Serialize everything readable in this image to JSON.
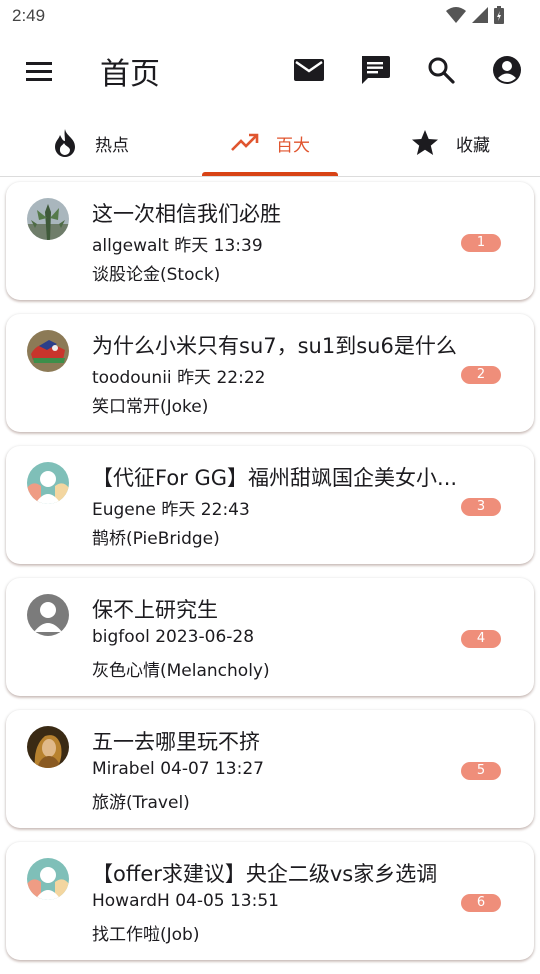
{
  "status_bar": {
    "time": "2:49"
  },
  "app_bar": {
    "title": "首页",
    "icons": [
      "menu-icon",
      "mail-icon",
      "chat-icon",
      "search-icon",
      "account-icon"
    ]
  },
  "tabs": [
    {
      "label": "热点",
      "icon": "flame-icon",
      "active": false
    },
    {
      "label": "百大",
      "icon": "trending-up-icon",
      "active": true
    },
    {
      "label": "收藏",
      "icon": "star-icon",
      "active": false
    }
  ],
  "colors": {
    "accent": "#e0552f",
    "indicator": "#d84315",
    "badge": "#ef8e7a"
  },
  "posts": [
    {
      "title": "这一次相信我们必胜",
      "author": "allgewalt",
      "time": "昨天 13:39",
      "board": "谈股论金(Stock)",
      "rank": "1",
      "avatar": "photo-cactus"
    },
    {
      "title": "为什么小米只有su7，su1到su6是什么",
      "author": "toodounii",
      "time": "昨天 22:22",
      "board": "笑口常开(Joke)",
      "rank": "2",
      "avatar": "photo-sneaker"
    },
    {
      "title": "【代征For GG】福州甜飒国企美女小...",
      "author": "Eugene",
      "time": "昨天 22:43",
      "board": "鹊桥(PieBridge)",
      "rank": "3",
      "avatar": "default-teal"
    },
    {
      "title": "保不上研究生",
      "author": "bigfool",
      "time": "2023-06-28",
      "board": "灰色心情(Melancholy)",
      "rank": "4",
      "avatar": "default-gray"
    },
    {
      "title": "五一去哪里玩不挤",
      "author": "Mirabel",
      "time": "04-07 13:27",
      "board": "旅游(Travel)",
      "rank": "5",
      "avatar": "photo-girl"
    },
    {
      "title": "【offer求建议】央企二级vs家乡选调",
      "author": "HowardH",
      "time": "04-05 13:51",
      "board": "找工作啦(Job)",
      "rank": "6",
      "avatar": "default-teal"
    }
  ]
}
